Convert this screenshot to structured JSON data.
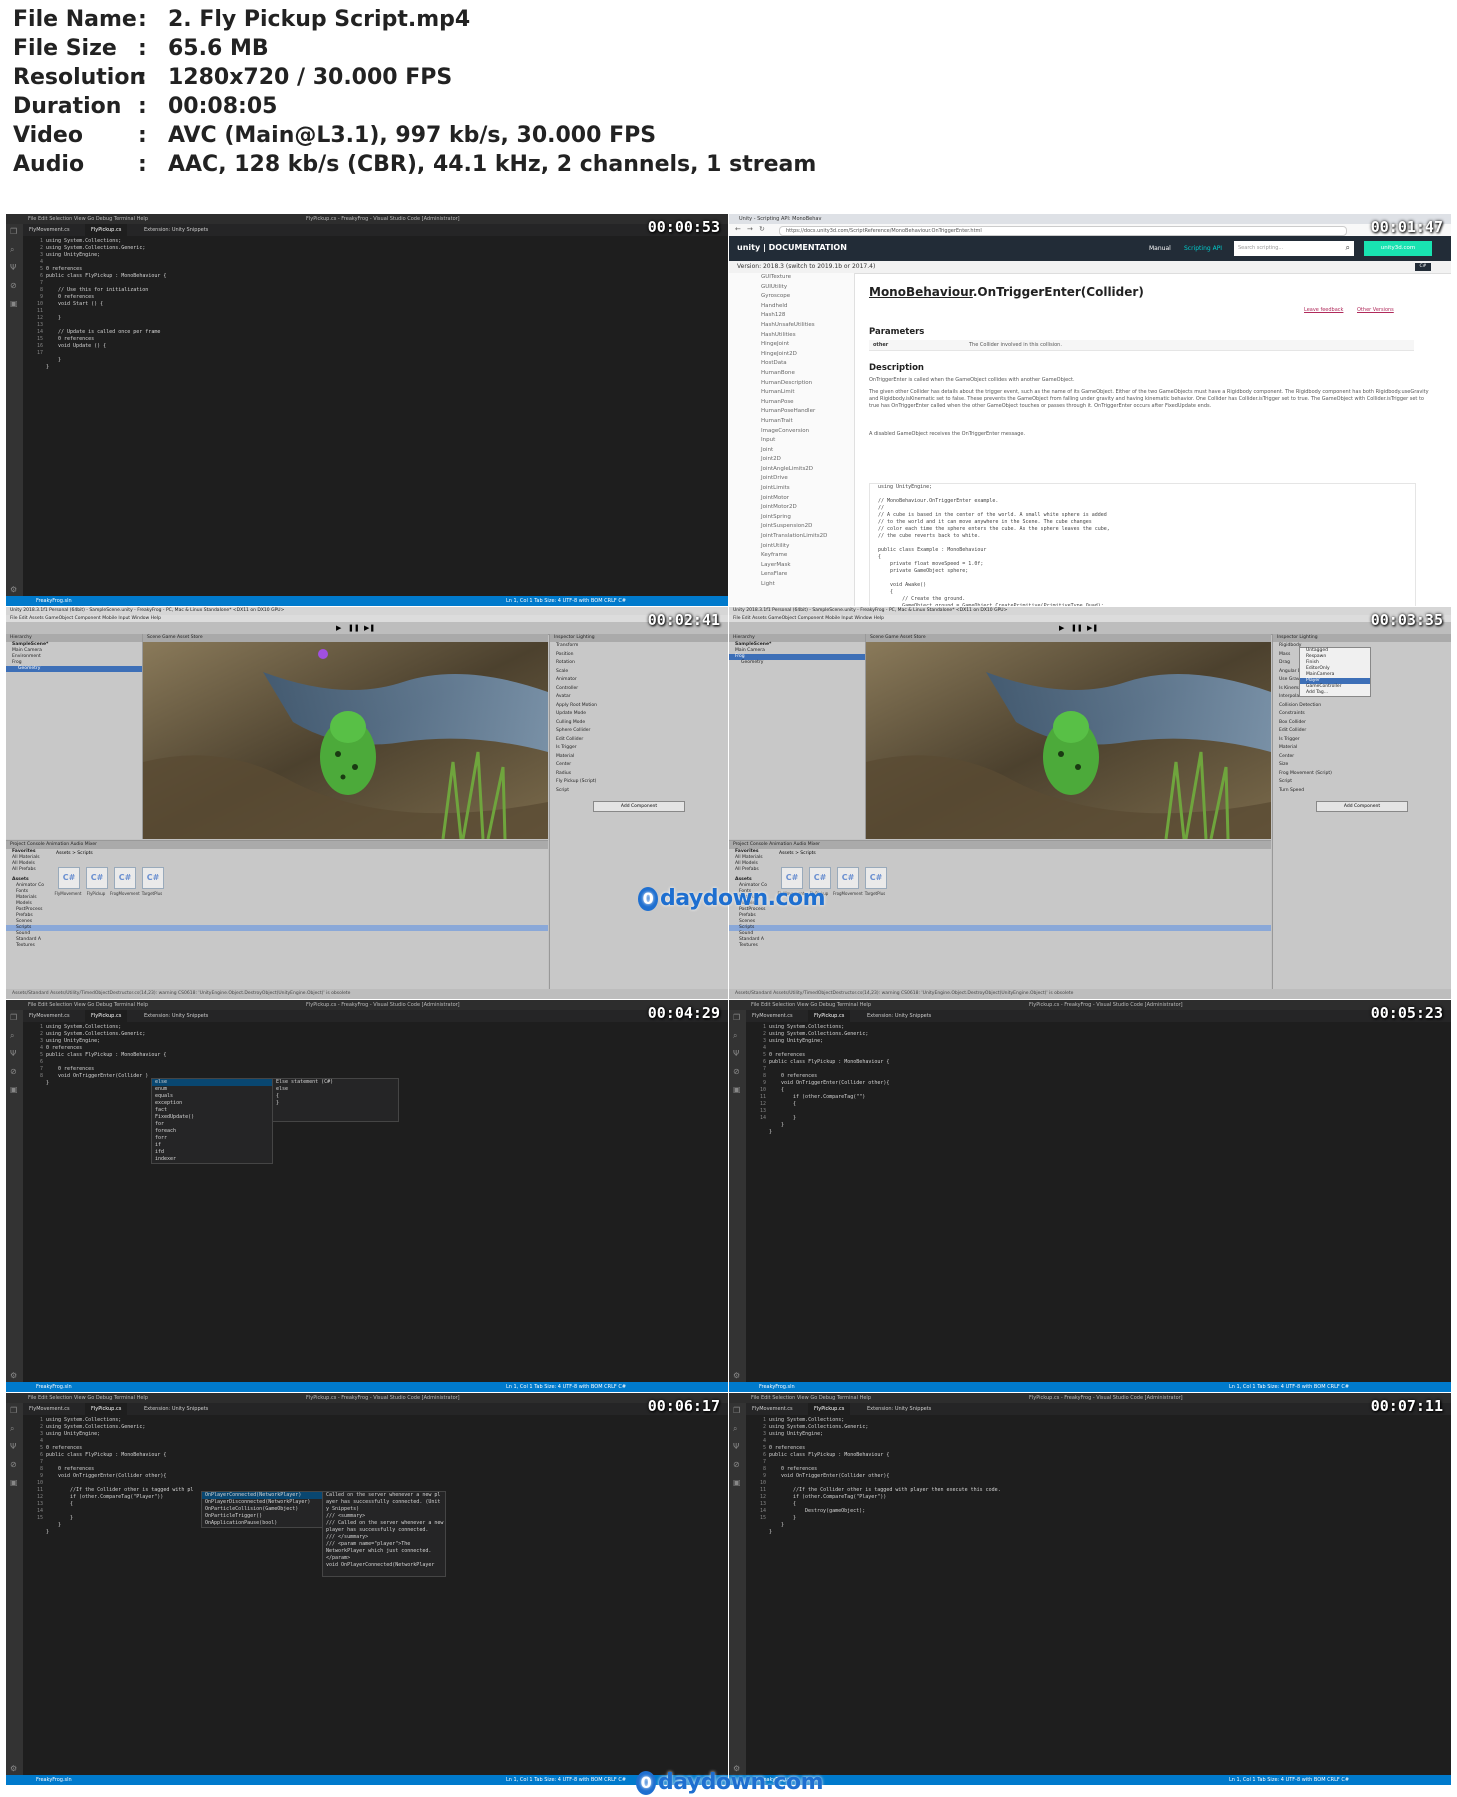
{
  "info": [
    {
      "key": "File Name",
      "value": "2. Fly Pickup Script.mp4"
    },
    {
      "key": "File Size",
      "value": "65.6 MB"
    },
    {
      "key": "Resolution",
      "value": "1280x720 / 30.000 FPS"
    },
    {
      "key": "Duration",
      "value": "00:08:05"
    },
    {
      "key": "Video",
      "value": "AVC (Main@L3.1), 997 kb/s, 30.000 FPS"
    },
    {
      "key": "Audio",
      "value": "AAC, 128 kb/s (CBR), 44.1 kHz, 2 channels, 1 stream"
    }
  ],
  "separator": ":",
  "timestamps": [
    "00:00:53",
    "00:01:47",
    "00:02:41",
    "00:03:35",
    "00:04:29",
    "00:05:23",
    "00:06:17",
    "00:07:11"
  ],
  "watermark": "daydown.com",
  "watermark_o": "0",
  "vscode": {
    "menu": "File  Edit  Selection  View  Go  Debug  Terminal  Help",
    "window_title": "FlyPickup.cs - FreakyFrog - Visual Studio Code [Administrator]",
    "tab_welcome": "FlyMovement.cs",
    "tab_active": "FlyPickup.cs",
    "tab_ext": "Extension: Unity Snippets",
    "status_left": "FreakyFrog.sln",
    "status_right": "Ln 1, Col 1   Tab Size: 4   UTF-8 with BOM   CRLF   C#"
  },
  "code_start": {
    "l1": "using System.Collections;",
    "l2": "using System.Collections.Generic;",
    "l3": "using UnityEngine;",
    "ref0": "0 references",
    "l5": "public class FlyPickup : MonoBehaviour {",
    "c_init": "// Use this for initialization",
    "start": "void Start () {",
    "close_inner": "}",
    "c_update": "// Update is called once per frame",
    "update": "void Update () {",
    "close": "}"
  },
  "code_trigger": {
    "sig": "void OnTriggerEnter(Collider other){",
    "sig_partial": "void OnTriggerEnter(Collider )",
    "if_partial": "if (other.CompareTag(\"\")",
    "comment": "//If the Collider other is tagged with player then execute this code.",
    "comment_partial": "//If the Collider other is tagged with pl",
    "if_full": "if (other.CompareTag(\"Player\"))",
    "open": "{",
    "destroy": "Destroy(gameObject);"
  },
  "autocomplete_1": [
    "else",
    "enum",
    "equals",
    "exception",
    "fact",
    "FixedUpdate()",
    "for",
    "foreach",
    "forr",
    "if",
    "ifd",
    "indexer"
  ],
  "autocomplete_1_doc": [
    "Else statement (C#)",
    "else",
    "{",
    "}"
  ],
  "autocomplete_2": [
    "OnPlayerConnected(NetworkPlayer)",
    "OnPlayerDisconnected(NetworkPlayer)",
    "OnParticleCollision(GameObject)",
    "OnParticleTrigger()",
    "OnApplicationPause(bool)"
  ],
  "autocomplete_2_doc": [
    "Called on the server whenever a new pl",
    "ayer has successfully connected. (Unit",
    "y Snippets)",
    "/// <summary>",
    "/// Called on the server whenever a new",
    "player has successfully connected.",
    "/// </summary>",
    "/// <param name=\"player\">The",
    "NetworkPlayer which just connected.",
    "</param>",
    "void OnPlayerConnected(NetworkPlayer"
  ],
  "docs": {
    "tab_title": "Unity - Scripting API: MonoBehav",
    "url": "https://docs.unity3d.com/ScriptReference/MonoBehaviour.OnTriggerEnter.html",
    "brand": "unity | DOCUMENTATION",
    "nav_manual": "Manual",
    "nav_scripting": "Scripting API",
    "search_placeholder": "Search scripting...",
    "site_button": "unity3d.com",
    "lang": "C#",
    "version_line": "Version: 2018.3 (switch to 2019.1b or 2017.4)",
    "sidebar": [
      "GUITexture",
      "GUIUtility",
      "Gyroscope",
      "Handheld",
      "Hash128",
      "HashUnsafeUtilities",
      "HashUtilities",
      "HingeJoint",
      "HingeJoint2D",
      "HostData",
      "HumanBone",
      "HumanDescription",
      "HumanLimit",
      "HumanPose",
      "HumanPoseHandler",
      "HumanTrait",
      "ImageConversion",
      "Input",
      "Joint",
      "Joint2D",
      "JointAngleLimits2D",
      "JointDrive",
      "JointLimits",
      "JointMotor",
      "JointMotor2D",
      "JointSpring",
      "JointSuspension2D",
      "JointTranslationLimits2D",
      "JointUtility",
      "Keyframe",
      "LayerMask",
      "LensFlare",
      "Light"
    ],
    "title_class": "MonoBehaviour",
    "title_method": ".OnTriggerEnter(Collider)",
    "leave_feedback": "Leave feedback",
    "other_versions": "Other Versions",
    "h_params": "Parameters",
    "param_name": "other",
    "param_desc": "The Collider involved in this collision.",
    "h_desc": "Description",
    "desc1": "OnTriggerEnter is called when the GameObject collides with another GameObject.",
    "desc2": "The given other Collider has details about the trigger event, such as the name of its GameObject. Either of the two GameObjects must have a Rigidbody component. The Rigidbody component has both Rigidbody.useGravity and Rigidbody.isKinematic set to false. These prevents the GameObject from falling under gravity and having kinematic behavior. One Collider has Collider.isTrigger set to true. The GameObject with Collider.isTrigger set to true has OnTriggerEnter called when the other GameObject touches or passes through it. OnTriggerEnter occurs after FixedUpdate ends.",
    "desc3": "A disabled GameObject receives the OnTriggerEnter message.",
    "code": [
      "using UnityEngine;",
      "",
      "// MonoBehaviour.OnTriggerEnter example.",
      "//",
      "// A cube is based in the center of the world. A small white sphere is added",
      "// to the world and it can move anywhere in the Scene. The cube changes",
      "// color each time the sphere enters the cube. As the sphere leaves the cube,",
      "// the cube reverts back to white.",
      "",
      "public class Example : MonoBehaviour",
      "{",
      "    private float moveSpeed = 1.0f;",
      "    private GameObject sphere;",
      "",
      "    void Awake()",
      "    {",
      "        // Create the ground.",
      "        GameObject ground = GameObject.CreatePrimitive(PrimitiveType.Quad);"
    ]
  },
  "unity": {
    "title": "Unity 2018.3.1f1 Personal (64bit) - SampleScene.unity - FreakyFrog - PC, Mac & Linux Standalone* <DX11 on DX10 GPU>",
    "menu": "File  Edit  Assets  GameObject  Component  Mobile Input  Window  Help",
    "hierarchy": "Hierarchy",
    "scene_root": "SampleScene*",
    "h_items": [
      "Main Camera",
      "Environment",
      "Frog",
      "Geometry"
    ],
    "scene_tab": "Scene   Game   Asset Store",
    "inspector": "Inspector   Lighting",
    "project": "Project   Console   Animation   Audio Mixer",
    "favorites": "Favorites",
    "fav_items": [
      "All Materials",
      "All Models",
      "All Prefabs"
    ],
    "assets": "Assets",
    "asset_folders": [
      "Animator Co",
      "Fonts",
      "Materials",
      "Models",
      "PostProcess",
      "Prefabs",
      "Scenes",
      "Scripts",
      "Sound",
      "Standard A",
      "Textures"
    ],
    "breadcrumb": "Assets > Scripts",
    "scripts": [
      "FlyMovement",
      "FlyPickup",
      "FrogMovement",
      "TargetPlus"
    ],
    "cs": "C#",
    "insp_rows_a": [
      "Transform",
      "Position",
      "Rotation",
      "Scale",
      "Animator",
      "Controller",
      "Avatar",
      "Apply Root Motion",
      "Update Mode",
      "Culling Mode",
      "Sphere Collider",
      "Edit Collider",
      "Is Trigger",
      "Material",
      "Center",
      "Radius",
      "Fly Pickup (Script)",
      "Script"
    ],
    "add_component": "Add Component",
    "tag_menu": [
      "Untagged",
      "Respawn",
      "Finish",
      "EditorOnly",
      "MainCamera",
      "Player",
      "GameController",
      "Add Tag..."
    ],
    "insp_rows_b": [
      "Rigidbody",
      "Mass",
      "Drag",
      "Angular Drag",
      "Use Gravity",
      "Is Kinematic",
      "Interpolate",
      "Collision Detection",
      "Constraints",
      "Box Collider",
      "Edit Collider",
      "Is Trigger",
      "Material",
      "Center",
      "Size",
      "Frog Movement (Script)",
      "Script",
      "Turn Speed"
    ],
    "status": "Assets/Standard Assets/Utility/TimedObjectDestructor.cs(14,23): warning CS0618: 'UnityEngine.Object.DestroyObject(UnityEngine.Object)' is obsolete"
  }
}
